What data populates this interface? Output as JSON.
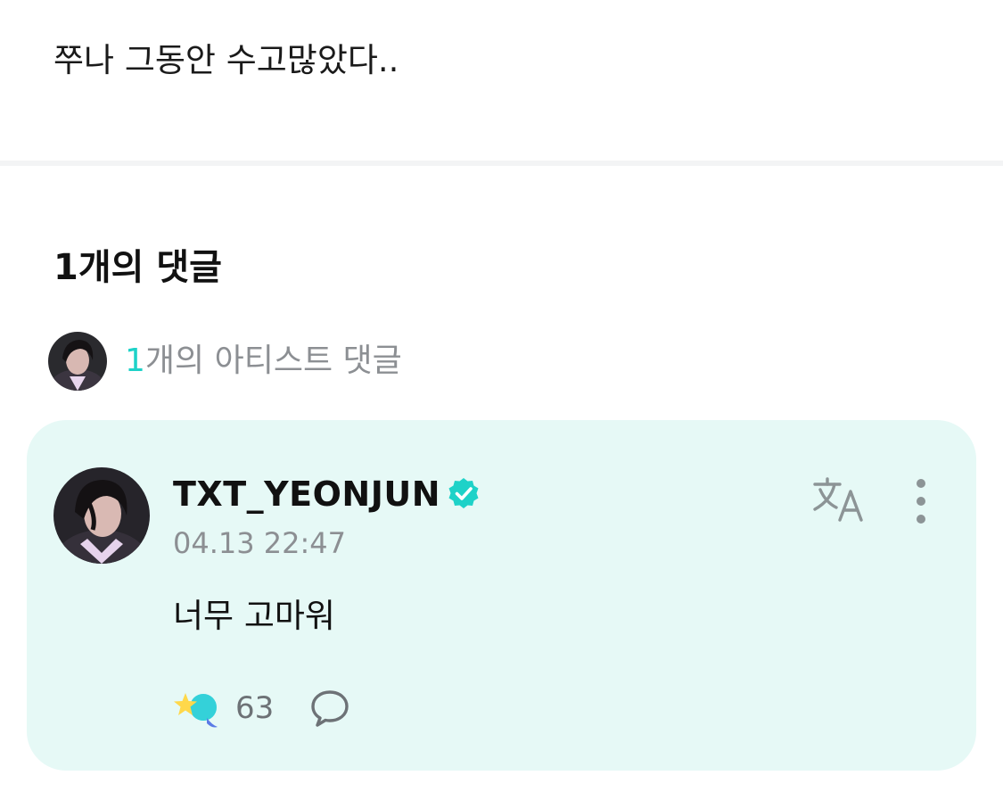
{
  "post": {
    "body": "쭈나 그동안 수고많았다.."
  },
  "comments": {
    "heading": "1개의 댓글",
    "artist_summary": {
      "count": "1",
      "label": "개의 아티스트 댓글"
    }
  },
  "comment": {
    "author": "TXT_YEONJUN",
    "verified": true,
    "timestamp": "04.13 22:47",
    "text": "너무 고마워",
    "like_count": "63"
  },
  "icons": {
    "verified": "verified-badge-icon",
    "translate": "translate-icon",
    "more": "more-vertical-icon",
    "like": "sparkle-like-icon",
    "reply": "comment-bubble-icon"
  },
  "colors": {
    "accent": "#1ed2c8",
    "card_background": "#e6f9f6",
    "muted_text": "#8c8f93"
  }
}
